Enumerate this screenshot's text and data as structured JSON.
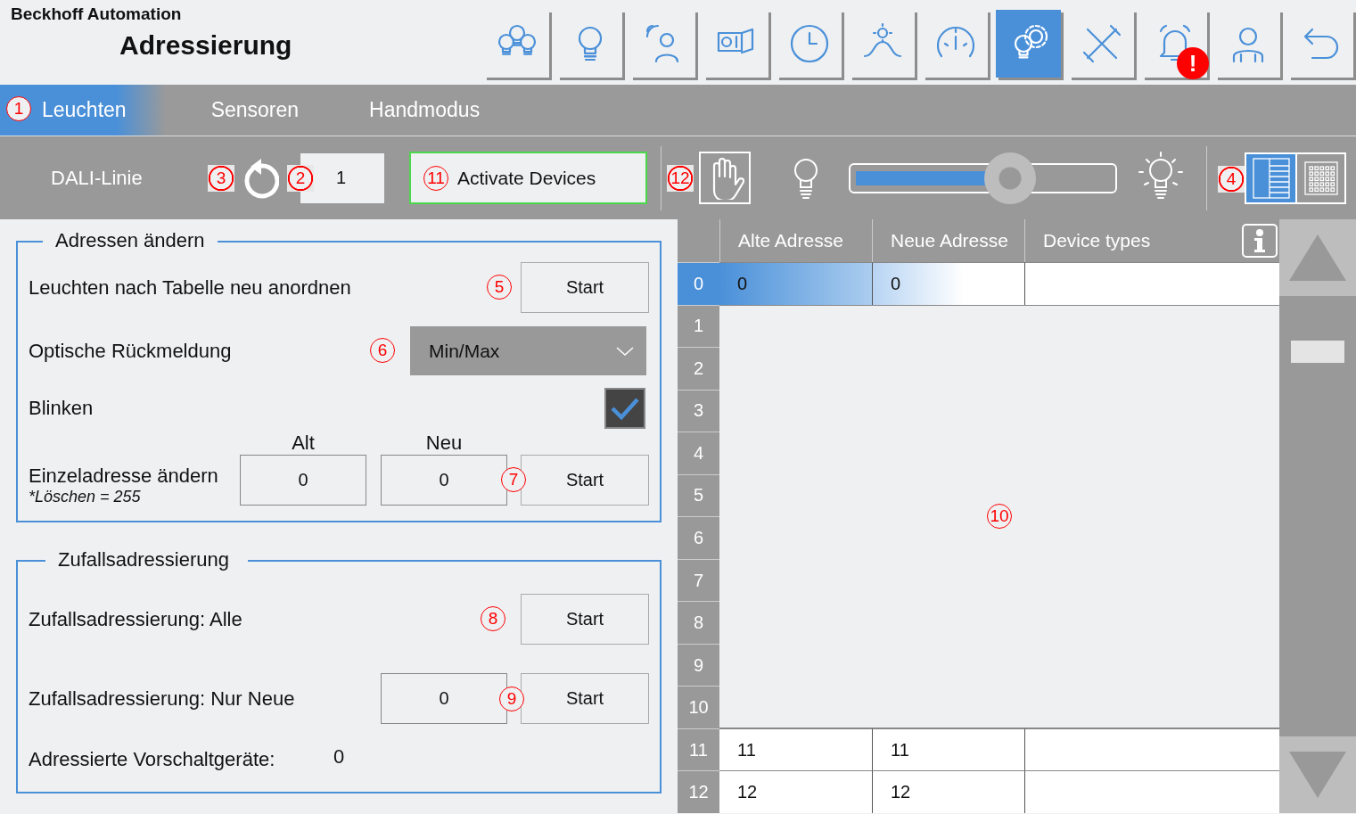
{
  "header": {
    "company": "Beckhoff Automation",
    "title": "Adressierung",
    "buttons": [
      {
        "selected": false
      },
      {
        "selected": false
      },
      {
        "selected": false
      },
      {
        "selected": false
      },
      {
        "selected": false
      },
      {
        "selected": false
      },
      {
        "selected": false
      },
      {
        "selected": true
      },
      {
        "selected": false
      },
      {
        "selected": false,
        "badge": "!"
      },
      {
        "selected": false
      },
      {
        "selected": false
      }
    ]
  },
  "tabs": [
    {
      "label": "Leuchten",
      "selected": true,
      "annotation": "1"
    },
    {
      "label": "Sensoren",
      "selected": false
    },
    {
      "label": "Handmodus",
      "selected": false
    }
  ],
  "toolbar": {
    "line_label": "DALI-Linie",
    "reset_annotation": "3",
    "line_field": {
      "value": "1",
      "annotation": "2"
    },
    "activate_button": {
      "label": "Activate Devices",
      "annotation": "11"
    },
    "hand_button": {
      "annotation": "12"
    },
    "dimmer": {
      "level": 0.6
    },
    "view_toggle": {
      "annotation": "4",
      "options": [
        {
          "selected": true
        },
        {
          "selected": false
        }
      ]
    }
  },
  "address_change": {
    "legend": "Adressen ändern",
    "reorder": {
      "label": "Leuchten nach Tabelle neu anordnen",
      "annotation": "5",
      "button": "Start"
    },
    "feedback": {
      "label": "Optische Rückmeldung",
      "annotation": "6",
      "value": "Min/Max"
    },
    "blink": {
      "label": "Blinken",
      "checked": true
    },
    "single": {
      "label": "Einzeladresse ändern",
      "note": "*Löschen = 255",
      "old_label": "Alt",
      "new_label": "Neu",
      "old_value": "0",
      "new_value": "0",
      "annotation": "7",
      "button": "Start"
    }
  },
  "random": {
    "legend": "Zufallsadressierung",
    "all": {
      "label": "Zufallsadressierung: Alle",
      "annotation": "8",
      "button": "Start"
    },
    "new_only": {
      "label": "Zufallsadressierung: Nur Neue",
      "value": "0",
      "annotation": "9",
      "button": "Start"
    },
    "count": {
      "label": "Adressierte Vorschaltgeräte:",
      "value": "0"
    }
  },
  "table": {
    "columns": [
      "Alte Adresse",
      "Neue Adresse",
      "Device types"
    ],
    "annotation": "10",
    "rows": [
      {
        "number": "0",
        "old": "0",
        "new": "0",
        "selected": true
      },
      {
        "number": "1",
        "selected": false
      },
      {
        "number": "2",
        "selected": false
      },
      {
        "number": "3",
        "selected": false
      },
      {
        "number": "4",
        "selected": false
      },
      {
        "number": "5",
        "selected": false
      },
      {
        "number": "6",
        "selected": false
      },
      {
        "number": "7",
        "selected": false
      },
      {
        "number": "8",
        "selected": false
      },
      {
        "number": "9",
        "selected": false
      },
      {
        "number": "10",
        "selected": false
      },
      {
        "number": "11",
        "old": "11",
        "new": "11",
        "selected": false
      },
      {
        "number": "12",
        "old": "12",
        "new": "12",
        "selected": false
      }
    ]
  }
}
